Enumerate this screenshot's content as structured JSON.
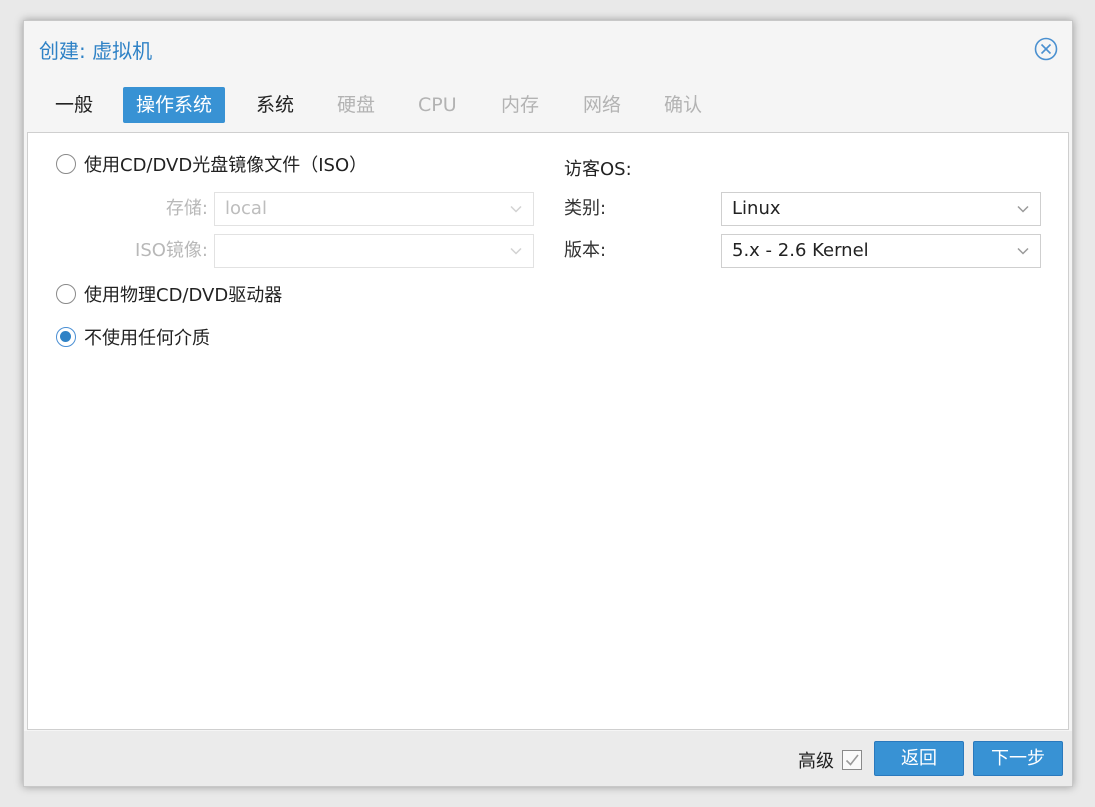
{
  "dialog": {
    "title": "创建: 虚拟机"
  },
  "tabs": [
    {
      "label": "一般",
      "state": "normal"
    },
    {
      "label": "操作系统",
      "state": "active"
    },
    {
      "label": "系统",
      "state": "normal"
    },
    {
      "label": "硬盘",
      "state": "disabled"
    },
    {
      "label": "CPU",
      "state": "disabled"
    },
    {
      "label": "内存",
      "state": "disabled"
    },
    {
      "label": "网络",
      "state": "disabled"
    },
    {
      "label": "确认",
      "state": "disabled"
    }
  ],
  "media": {
    "iso_option": "使用CD/DVD光盘镜像文件（ISO）",
    "storage_label": "存储:",
    "storage_value": "local",
    "iso_label": "ISO镜像:",
    "iso_value": "",
    "physical_option": "使用物理CD/DVD驱动器",
    "none_option": "不使用任何介质",
    "selected": "none"
  },
  "guest_os": {
    "heading": "访客OS:",
    "type_label": "类别:",
    "type_value": "Linux",
    "version_label": "版本:",
    "version_value": "5.x - 2.6 Kernel"
  },
  "footer": {
    "advanced_label": "高级",
    "back_label": "返回",
    "next_label": "下一步"
  },
  "colors": {
    "accent": "#3892d4",
    "title": "#2f82c6"
  }
}
